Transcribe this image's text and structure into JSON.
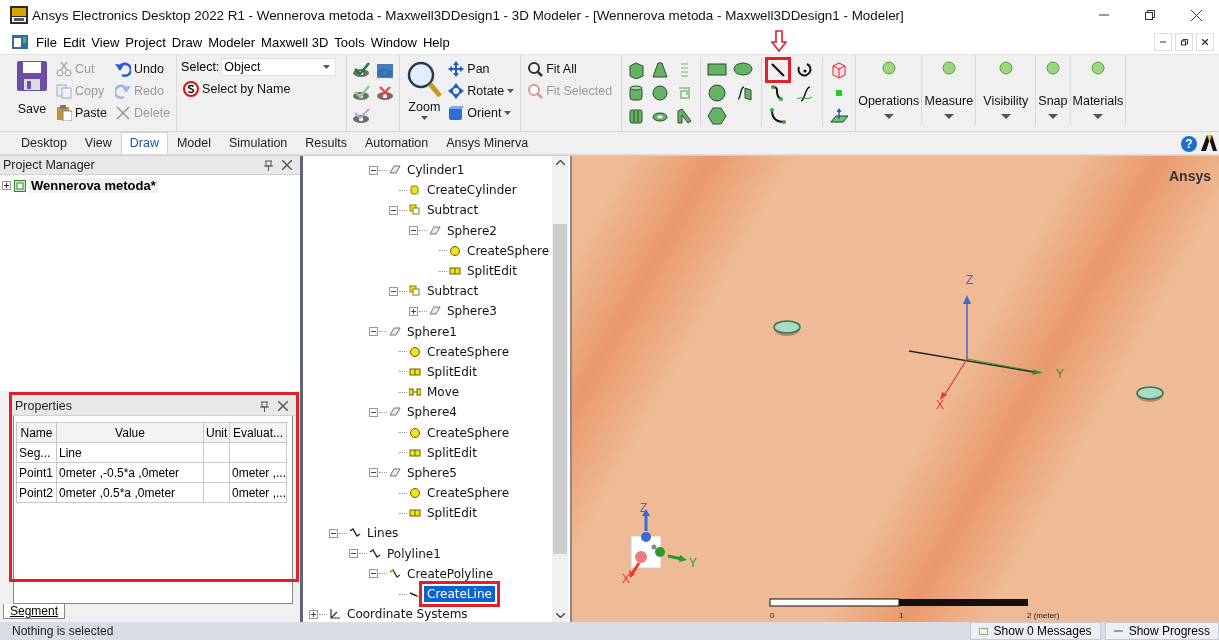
{
  "window": {
    "title": "Ansys Electronics Desktop 2022 R1 - Wennerova metoda - Maxwell3DDesign1 - 3D Modeler - [Wennerova metoda - Maxwell3DDesign1 - Modeler]"
  },
  "menu": [
    "File",
    "Edit",
    "View",
    "Project",
    "Draw",
    "Modeler",
    "Maxwell 3D",
    "Tools",
    "Window",
    "Help"
  ],
  "ribbon": {
    "save": {
      "label": "Save",
      "disabled": false
    },
    "clipboard": [
      {
        "label": "Cut",
        "disabled": true
      },
      {
        "label": "Copy",
        "disabled": true
      },
      {
        "label": "Paste",
        "disabled": false
      },
      {
        "label": "Undo",
        "disabled": false
      },
      {
        "label": "Redo",
        "disabled": true
      },
      {
        "label": "Delete",
        "disabled": true
      }
    ],
    "select": {
      "label": "Select:",
      "value": "Object",
      "by_name": "Select by Name"
    },
    "view": {
      "zoom": "Zoom",
      "tools": [
        {
          "label": "Pan",
          "has_menu": false
        },
        {
          "label": "Rotate",
          "has_menu": true
        },
        {
          "label": "Orient",
          "has_menu": true
        }
      ]
    },
    "fit": [
      {
        "label": "Fit All",
        "disabled": false
      },
      {
        "label": "Fit Selected",
        "disabled": true
      }
    ],
    "line_tool": {
      "highlighted": true
    },
    "menus": [
      "Operations",
      "Measure",
      "Visibility",
      "Snap",
      "Materials"
    ]
  },
  "tabs": [
    {
      "label": "Desktop",
      "selected": false
    },
    {
      "label": "View",
      "selected": false
    },
    {
      "label": "Draw",
      "selected": true
    },
    {
      "label": "Model",
      "selected": false
    },
    {
      "label": "Simulation",
      "selected": false
    },
    {
      "label": "Results",
      "selected": false
    },
    {
      "label": "Automation",
      "selected": false
    },
    {
      "label": "Ansys Minerva",
      "selected": false
    }
  ],
  "help_button": "?",
  "project_manager": {
    "title": "Project Manager",
    "project": {
      "name": "Wennerova metoda*",
      "expanded": false
    }
  },
  "properties": {
    "title": "Properties",
    "highlighted": true,
    "columns": [
      "Name",
      "Value",
      "Unit",
      "Evaluat..."
    ],
    "rows": [
      {
        "name": "Seg...",
        "value": "Line"
      },
      {
        "name": "Point1",
        "value": "0meter ,-0.5*a ,0meter",
        "evaluated": "0meter ,..."
      },
      {
        "name": "Point2",
        "value": "0meter ,0.5*a ,0meter",
        "evaluated": "0meter ,..."
      }
    ],
    "tabs": [
      {
        "label": "Segment",
        "selected": true
      }
    ]
  },
  "tree": {
    "items": [
      {
        "children": [
          {
            "children": [
              {
                "children": [
                  {
                    "label": "Cylinder1",
                    "kind": "object",
                    "expanded": true,
                    "selected": false,
                    "children": [
                      {
                        "label": "CreateCylinder",
                        "kind": "create-cylinder",
                        "selected": false
                      },
                      {
                        "label": "Subtract",
                        "kind": "subtract",
                        "expanded": true,
                        "selected": false,
                        "children": [
                          {
                            "label": "Sphere2",
                            "kind": "object",
                            "expanded": true,
                            "selected": false,
                            "children": [
                              {
                                "label": "CreateSphere",
                                "kind": "create-sphere",
                                "selected": false
                              },
                              {
                                "label": "SplitEdit",
                                "kind": "split-edit",
                                "selected": false
                              }
                            ]
                          }
                        ]
                      },
                      {
                        "label": "Subtract",
                        "kind": "subtract",
                        "expanded": true,
                        "selected": false,
                        "children": [
                          {
                            "label": "Sphere3",
                            "kind": "object",
                            "expanded": false,
                            "selected": false
                          }
                        ]
                      }
                    ]
                  },
                  {
                    "label": "Sphere1",
                    "kind": "object",
                    "expanded": true,
                    "selected": false,
                    "children": [
                      {
                        "label": "CreateSphere",
                        "kind": "create-sphere",
                        "selected": false
                      },
                      {
                        "label": "SplitEdit",
                        "kind": "split-edit",
                        "selected": false
                      },
                      {
                        "label": "Move",
                        "kind": "move",
                        "selected": false
                      }
                    ]
                  },
                  {
                    "label": "Sphere4",
                    "kind": "object",
                    "expanded": true,
                    "selected": false,
                    "children": [
                      {
                        "label": "CreateSphere",
                        "kind": "create-sphere",
                        "selected": false
                      },
                      {
                        "label": "SplitEdit",
                        "kind": "split-edit",
                        "selected": false
                      }
                    ]
                  },
                  {
                    "label": "Sphere5",
                    "kind": "object",
                    "expanded": true,
                    "selected": false,
                    "children": [
                      {
                        "label": "CreateSphere",
                        "kind": "create-sphere",
                        "selected": false
                      },
                      {
                        "label": "SplitEdit",
                        "kind": "split-edit",
                        "selected": false
                      }
                    ]
                  }
                ]
              }
            ]
          },
          {
            "label": "Lines",
            "kind": "lines",
            "expanded": true,
            "selected": false,
            "children": [
              {
                "label": "Polyline1",
                "kind": "lines",
                "expanded": true,
                "selected": false,
                "children": [
                  {
                    "label": "CreatePolyline",
                    "kind": "polyline",
                    "expanded": true,
                    "selected": false,
                    "children": [
                      {
                        "label": "CreateLine",
                        "kind": "create-line",
                        "selected": true,
                        "highlighted": true
                      }
                    ]
                  }
                ]
              }
            ]
          }
        ]
      },
      {
        "label": "Coordinate Systems",
        "kind": "coordinate-system",
        "expanded": false,
        "selected": false
      }
    ]
  },
  "viewport": {
    "brand": "Ansys",
    "axes": {
      "z": "Z",
      "y": "Y",
      "x": "X"
    },
    "triad": {
      "z": "Z",
      "y": "Y",
      "x": "X"
    },
    "scale": [
      "0",
      "1",
      "2 (meter)"
    ]
  },
  "status": {
    "text": "Nothing is selected",
    "buttons": [
      "Show 0 Messages",
      "Show Progress"
    ]
  }
}
